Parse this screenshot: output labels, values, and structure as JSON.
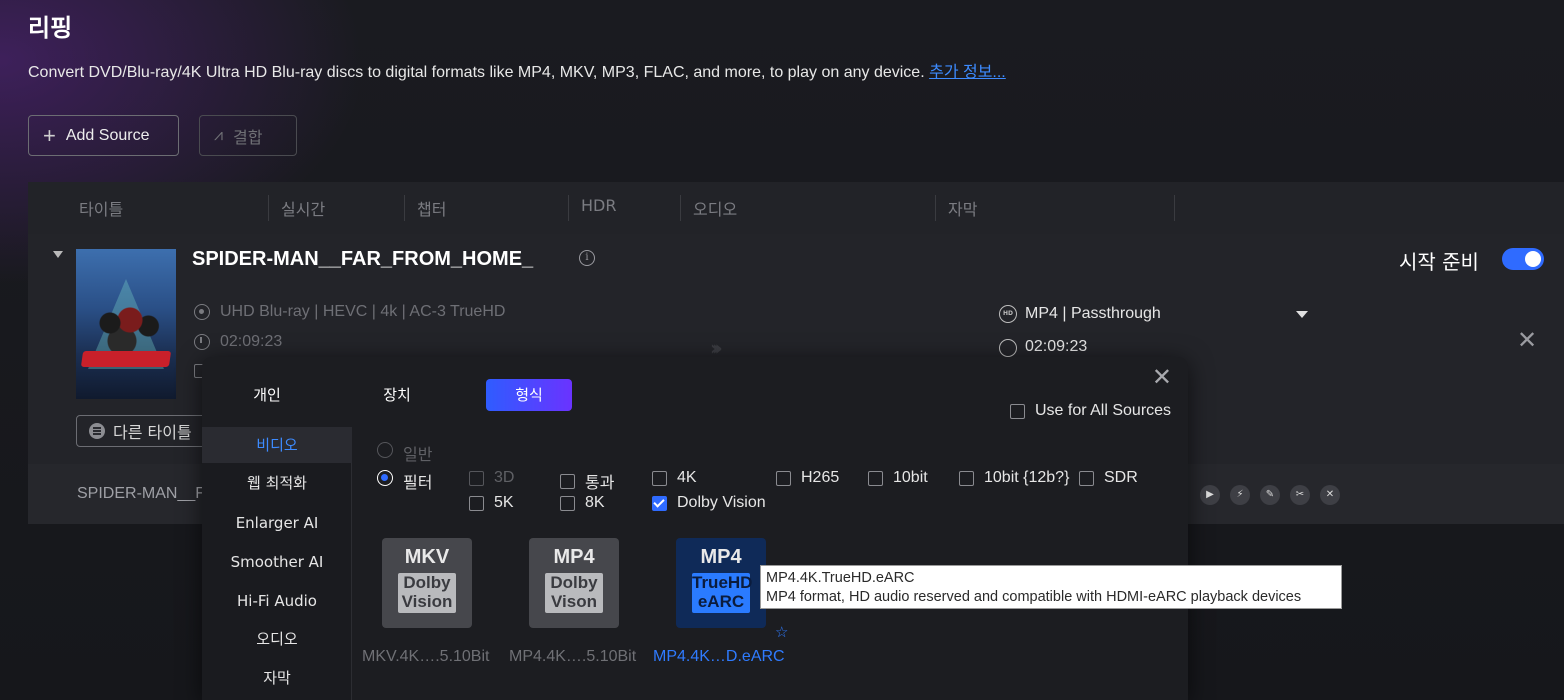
{
  "page": {
    "title": "리핑",
    "subtitle": "Convert DVD/Blu-ray/4K Ultra HD Blu-ray discs to digital formats like MP4, MKV, MP3, FLAC, and more, to play on any device.",
    "more_info_link": "추가 정보...",
    "add_source_label": "Add Source",
    "merge_label": "결합"
  },
  "table": {
    "headers": [
      "타이틀",
      "실시간",
      "챕터",
      "HDR",
      "오디오",
      "자막"
    ]
  },
  "item": {
    "title": "SPIDER-MAN__FAR_FROM_HOME_",
    "source_info": "UHD Blu-ray | HEVC | 4k | AC-3 TrueHD",
    "duration": "02:09:23",
    "output_format": "MP4 | Passthrough",
    "output_duration": "02:09:23",
    "ready_label": "시작 준비",
    "other_title_label": "다른 타이틀",
    "row2_title": "SPIDER-MAN__FA"
  },
  "popup": {
    "tabs": [
      "개인",
      "장치",
      "형식"
    ],
    "active_tab": "형식",
    "use_all_label": "Use for All Sources",
    "sidebar": [
      "비디오",
      "웹 최적화",
      "Enlarger AI",
      "Smoother AI",
      "Hi-Fi Audio",
      "오디오",
      "자막"
    ],
    "mode_general": "일반",
    "mode_filter": "필터",
    "filters_row1": [
      "3D",
      "통과",
      "4K",
      "H265",
      "10bit",
      "10bit {12b?}",
      "SDR"
    ],
    "filters_row2": [
      "5K",
      "8K",
      "Dolby Vision"
    ],
    "formats": [
      {
        "top": "MKV",
        "bottom": "Dolby Vision",
        "label": "MKV.4K….5.10Bit"
      },
      {
        "top": "MP4",
        "bottom": "Dolby Vison",
        "label": "MP4.4K….5.10Bit"
      },
      {
        "top": "MP4",
        "bottom": "TrueHD eARC",
        "label": "MP4.4K…D.eARC"
      }
    ]
  },
  "tooltip": {
    "line1": "MP4.4K.TrueHD.eARC",
    "line2": "MP4 format, HD audio reserved and compatible with HDMI-eARC playback devices"
  },
  "colors": {
    "accent": "#2f6bff",
    "link": "#3d8bff",
    "tab_gradient_start": "#2f5cff",
    "tab_gradient_end": "#6a33ff"
  }
}
